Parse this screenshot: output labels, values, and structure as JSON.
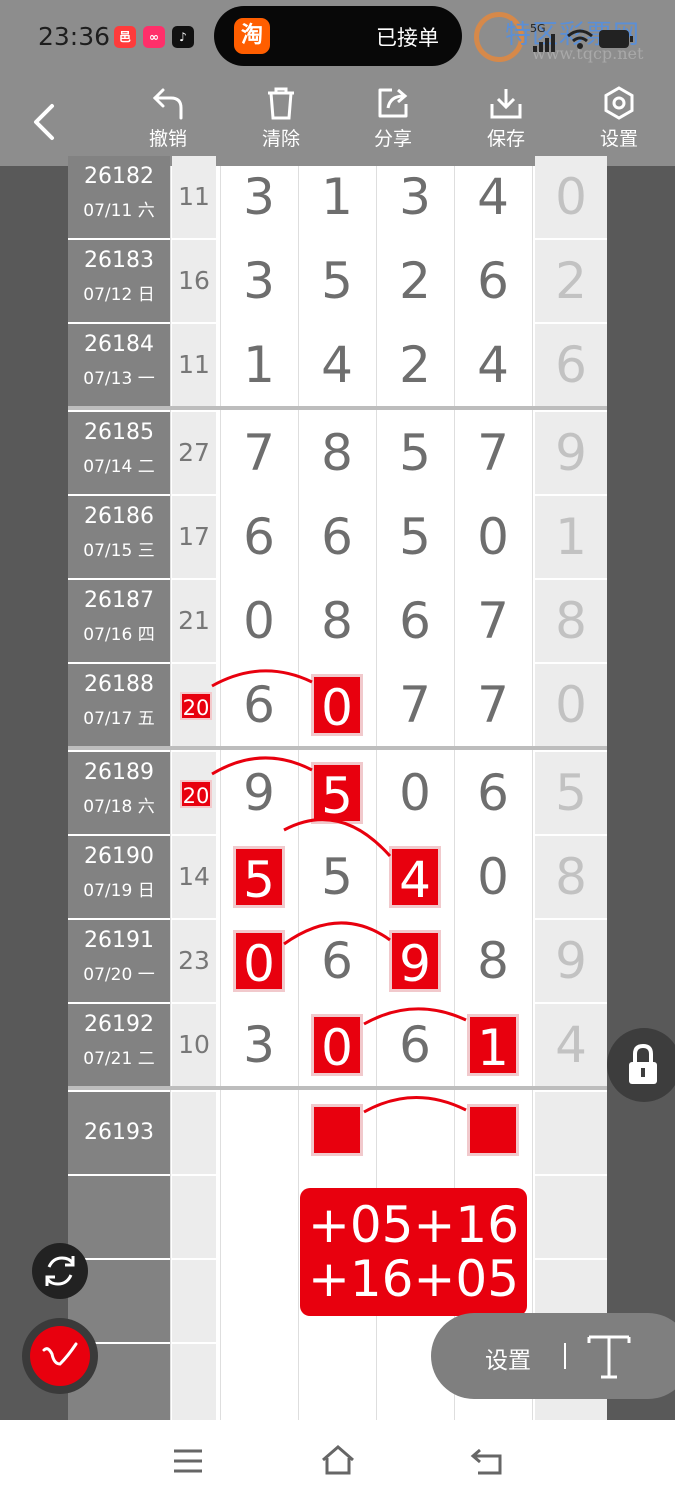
{
  "status": {
    "time": "23:36",
    "notice": "已接单",
    "signal": "5G"
  },
  "watermark": {
    "title": "特区彩票网",
    "url": "www.tqcp.net"
  },
  "toolbar": {
    "undo": "撤销",
    "clear": "清除",
    "share": "分享",
    "save": "保存",
    "settings": "设置"
  },
  "rows": [
    {
      "id": "26182",
      "date": "07/11 六",
      "sum": "11",
      "d": [
        "3",
        "1",
        "3",
        "4"
      ],
      "last": "0"
    },
    {
      "id": "26183",
      "date": "07/12 日",
      "sum": "16",
      "d": [
        "3",
        "5",
        "2",
        "6"
      ],
      "last": "2"
    },
    {
      "id": "26184",
      "date": "07/13 一",
      "sum": "11",
      "d": [
        "1",
        "4",
        "2",
        "4"
      ],
      "last": "6"
    },
    {
      "id": "26185",
      "date": "07/14 二",
      "sum": "27",
      "d": [
        "7",
        "8",
        "5",
        "7"
      ],
      "last": "9"
    },
    {
      "id": "26186",
      "date": "07/15 三",
      "sum": "17",
      "d": [
        "6",
        "6",
        "5",
        "0"
      ],
      "last": "1"
    },
    {
      "id": "26187",
      "date": "07/16 四",
      "sum": "21",
      "d": [
        "0",
        "8",
        "6",
        "7"
      ],
      "last": "8"
    },
    {
      "id": "26188",
      "date": "07/17 五",
      "sum": "20",
      "d": [
        "6",
        "0",
        "7",
        "7"
      ],
      "last": "0"
    },
    {
      "id": "26189",
      "date": "07/18 六",
      "sum": "20",
      "d": [
        "9",
        "5",
        "0",
        "6"
      ],
      "last": "5"
    },
    {
      "id": "26190",
      "date": "07/19 日",
      "sum": "14",
      "d": [
        "5",
        "5",
        "4",
        "0"
      ],
      "last": "8"
    },
    {
      "id": "26191",
      "date": "07/20 一",
      "sum": "23",
      "d": [
        "0",
        "6",
        "9",
        "8"
      ],
      "last": "9"
    },
    {
      "id": "26192",
      "date": "07/21 二",
      "sum": "10",
      "d": [
        "3",
        "0",
        "6",
        "1"
      ],
      "last": "4"
    }
  ],
  "next_issue": "26193",
  "prediction": {
    "line1": "+05+16",
    "line2": "+16+05"
  },
  "settings_pill": {
    "label": "设置"
  }
}
